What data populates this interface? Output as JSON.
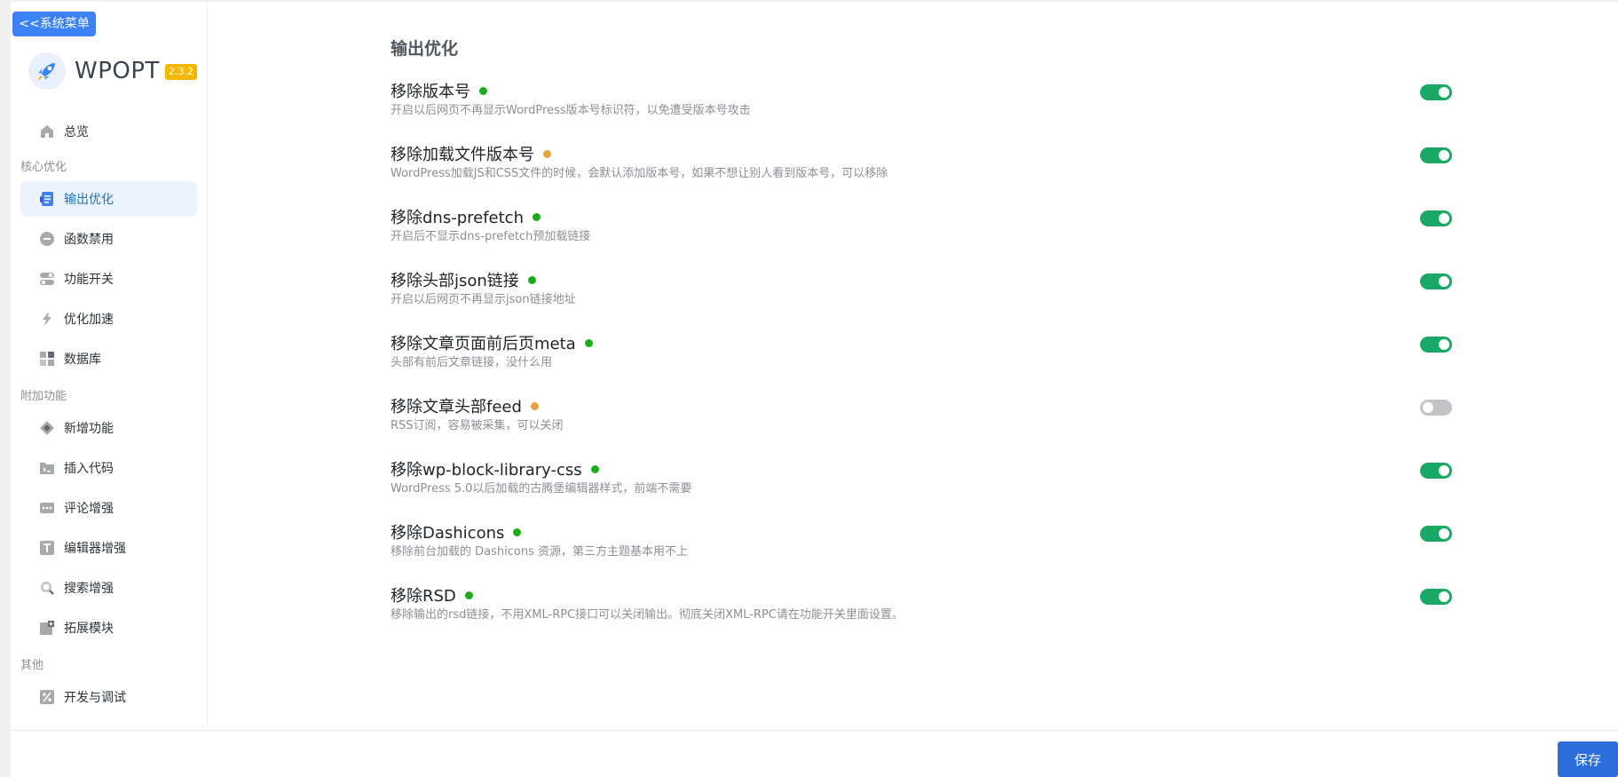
{
  "sidebar": {
    "system_menu_label": "<<系统菜单",
    "logo_text": "WPOPT",
    "version": "2.3.2",
    "items": [
      {
        "label": "总览",
        "icon": "home-icon"
      },
      {
        "label": "输出优化",
        "icon": "list-icon",
        "active": true
      },
      {
        "label": "函数禁用",
        "icon": "minus-circle-icon"
      },
      {
        "label": "功能开关",
        "icon": "toggle-icon"
      },
      {
        "label": "优化加速",
        "icon": "lightning-icon"
      },
      {
        "label": "数据库",
        "icon": "grid-icon"
      },
      {
        "label": "新增功能",
        "icon": "diamond-icon"
      },
      {
        "label": "插入代码",
        "icon": "code-icon"
      },
      {
        "label": "评论增强",
        "icon": "comment-icon"
      },
      {
        "label": "编辑器增强",
        "icon": "text-icon"
      },
      {
        "label": "搜索增强",
        "icon": "search-icon"
      },
      {
        "label": "拓展模块",
        "icon": "puzzle-icon"
      },
      {
        "label": "开发与调试",
        "icon": "percent-icon"
      }
    ],
    "groups": [
      "核心优化",
      "附加功能",
      "其他"
    ]
  },
  "main": {
    "section_title": "输出优化",
    "options": [
      {
        "title": "移除版本号",
        "dot": "green",
        "desc": "开启以后网页不再显示WordPress版本号标识符，以免遭受版本号攻击",
        "enabled": true
      },
      {
        "title": "移除加载文件版本号",
        "dot": "orange",
        "desc": "WordPress加载JS和CSS文件的时候，会默认添加版本号，如果不想让别人看到版本号，可以移除",
        "enabled": true
      },
      {
        "title": "移除dns-prefetch",
        "dot": "green",
        "desc": "开启后不显示dns-prefetch预加载链接",
        "enabled": true
      },
      {
        "title": "移除头部json链接",
        "dot": "green",
        "desc": "开启以后网页不再显示json链接地址",
        "enabled": true
      },
      {
        "title": "移除文章页面前后页meta",
        "dot": "green",
        "desc": "头部有前后文章链接，没什么用",
        "enabled": true
      },
      {
        "title": "移除文章头部feed",
        "dot": "orange",
        "desc": "RSS订阅，容易被采集，可以关闭",
        "enabled": false
      },
      {
        "title": "移除wp-block-library-css",
        "dot": "green",
        "desc": "WordPress 5.0以后加载的古腾堡编辑器样式，前端不需要",
        "enabled": true
      },
      {
        "title": "移除Dashicons",
        "dot": "green",
        "desc": "移除前台加载的 Dashicons 资源，第三方主题基本用不上",
        "enabled": true
      },
      {
        "title": "移除RSD",
        "dot": "green",
        "desc": "移除输出的rsd链接，不用XML-RPC接口可以关闭输出。彻底关闭XML-RPC请在功能开关里面设置。",
        "enabled": true
      }
    ]
  },
  "footer": {
    "save_label": "保存"
  },
  "colors": {
    "accent": "#3b82f6",
    "toggle_on": "#19a866",
    "toggle_off": "#c3c4c7",
    "dot_green": "#1aad19",
    "dot_orange": "#e6a23c"
  }
}
